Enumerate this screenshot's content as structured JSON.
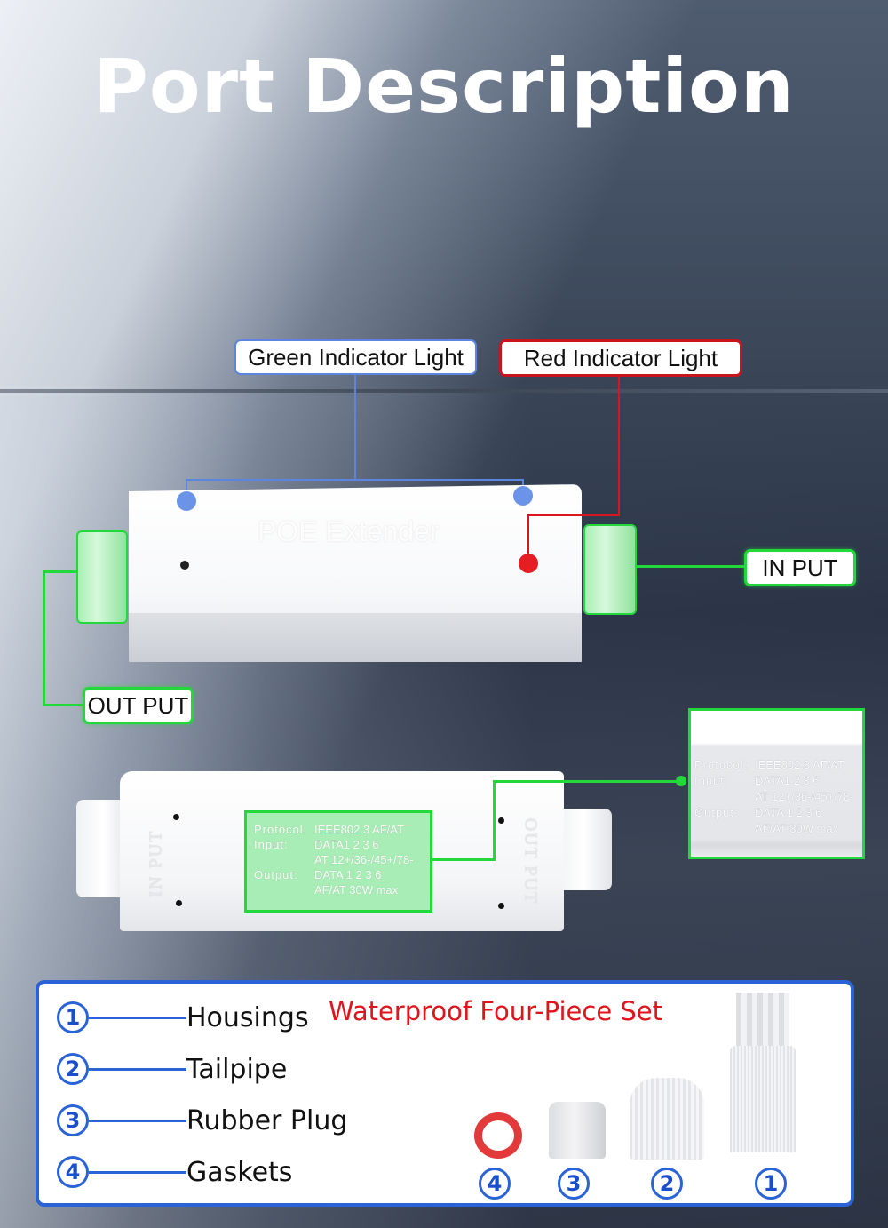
{
  "title": "Port Description",
  "callouts": {
    "green_indicator": "Green Indicator Light",
    "red_indicator": "Red Indicator Light",
    "input": "IN PUT",
    "output": "OUT PUT"
  },
  "device": {
    "emboss_label": "POE Extender",
    "side_input": "IN PUT",
    "side_output": "OUT PUT",
    "spec": {
      "protocol_key": "Protocol:",
      "protocol_val": "IEEE802.3 AF/AT",
      "input_key": "Input:",
      "input_line1": "DATA1 2 3 6",
      "input_line2": "AT 12+/36-/45+/78-",
      "output_key": "Output:",
      "output_line1": "DATA 1 2 3 6",
      "output_line2": "AF/AT 30W  max"
    }
  },
  "colors": {
    "green_callout": "#22d83a",
    "blue_callout": "#5a86e0",
    "red_callout": "#d8161e",
    "panel_border": "#2a63d6",
    "set_title": "#e0141c"
  },
  "parts_panel": {
    "set_title": "Waterproof Four-Piece Set",
    "parts": [
      {
        "number": "1",
        "name": "Housings"
      },
      {
        "number": "2",
        "name": "Tailpipe"
      },
      {
        "number": "3",
        "name": "Rubber Plug"
      },
      {
        "number": "4",
        "name": "Gaskets"
      }
    ],
    "image_numbers": [
      "4",
      "3",
      "2",
      "1"
    ]
  }
}
